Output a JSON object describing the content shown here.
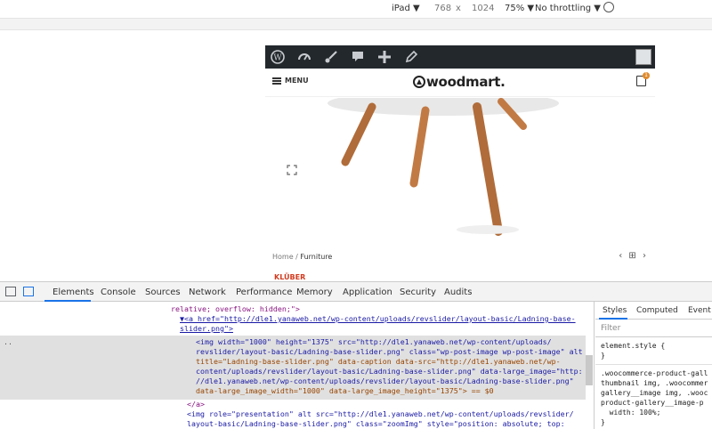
{
  "device_toolbar": {
    "device": "iPad ▼",
    "width": "768",
    "times": "x",
    "height": "1024",
    "zoom": "75% ▼",
    "throttling": "No throttling ▼"
  },
  "site": {
    "menu_label": "MENU",
    "logo": "woodmart.",
    "cart_count": "1",
    "breadcrumb_home": "Home",
    "breadcrumb_sep": "/",
    "breadcrumb_current": "Furniture",
    "brand": "KLÜBER"
  },
  "devtools": {
    "tabs": [
      "Elements",
      "Console",
      "Sources",
      "Network",
      "Performance",
      "Memory",
      "Application",
      "Security",
      "Audits"
    ],
    "code_lines": [
      "relative; overflow: hidden;\">",
      "▼<a href=\"http://dle1.yanaweb.net/wp-content/uploads/revslider/layout-basic/Ladning-base-",
      "slider.png\">",
      "<img width=\"1000\" height=\"1375\" src=\"http://dle1.yanaweb.net/wp-content/uploads/",
      "revslider/layout-basic/Ladning-base-slider.png\" class=\"wp-post-image wp-post-image\" alt",
      "title=\"Ladning-base-slider.png\" data-caption data-src=\"http://dle1.yanaweb.net/wp-",
      "content/uploads/revslider/layout-basic/Ladning-base-slider.png\" data-large_image=\"http:",
      "//dle1.yanaweb.net/wp-content/uploads/revslider/layout-basic/Ladning-base-slider.png\"",
      "data-large_image_width=\"1000\" data-large_image_height=\"1375\"> == $0",
      "</a>",
      "<img role=\"presentation\" alt src=\"http://dle1.yanaweb.net/wp-content/uploads/revslider/",
      "layout-basic/Ladning-base-slider.png\" class=\"zoomImg\" style=\"position: absolute; top:"
    ],
    "selected_marker": "..",
    "sidebar_tabs": [
      "Styles",
      "Computed",
      "Event"
    ],
    "filter_placeholder": "Filter",
    "style_rules": [
      "element.style {\n}",
      ".woocommerce-product-gall\nthumbnail img, .woocommer\ngallery__image img, .wooc\nproduct-gallery__image-p\n  width: 100%;\n}"
    ]
  }
}
